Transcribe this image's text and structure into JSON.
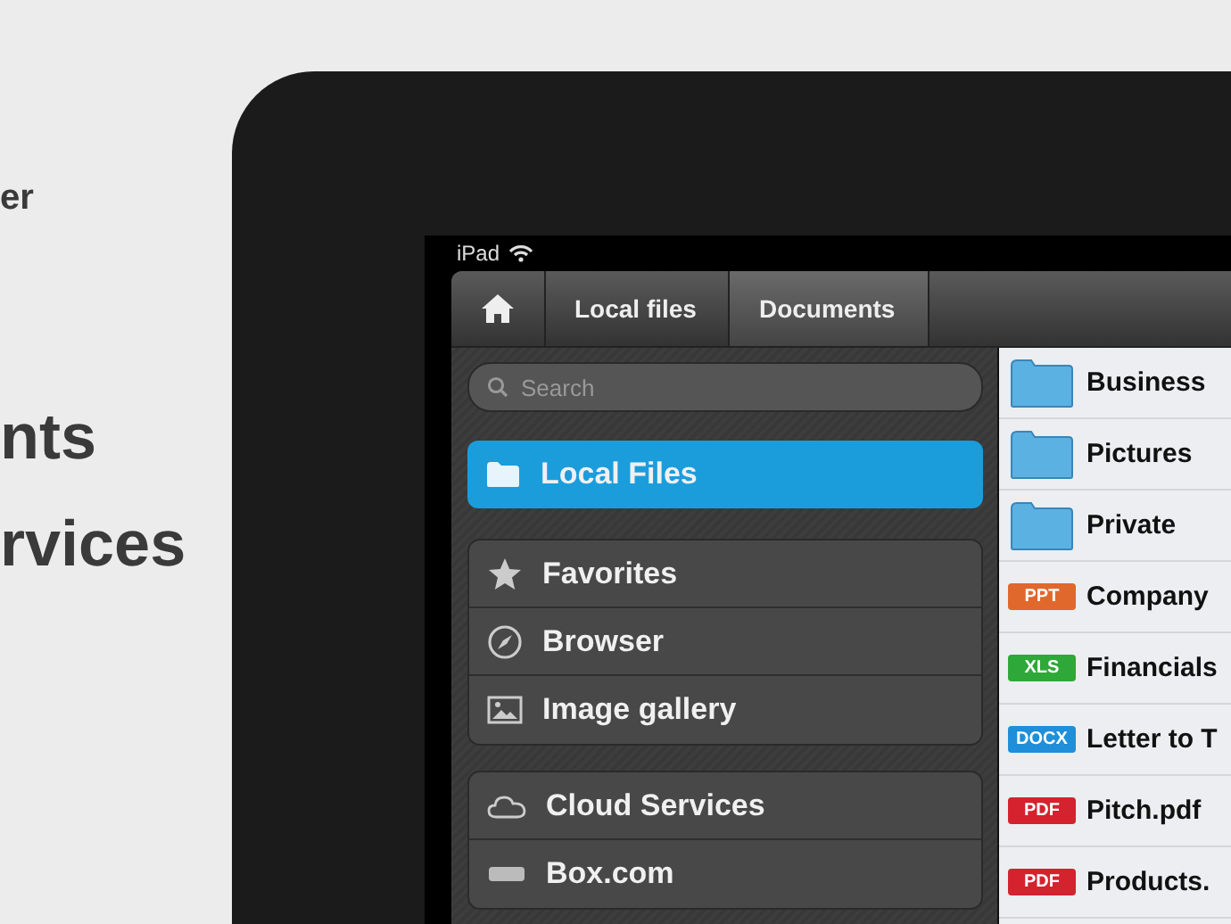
{
  "promo_text": [
    {
      "text": "er",
      "kind": "small"
    },
    {
      "text": "nts",
      "kind": "large"
    },
    {
      "text": "rvices",
      "kind": "large"
    }
  ],
  "status_bar": {
    "device": "iPad"
  },
  "breadcrumbs": [
    "Local files",
    "Documents"
  ],
  "search": {
    "placeholder": "Search"
  },
  "sidebar": {
    "top": {
      "label": "Local Files",
      "selected": true
    },
    "groups": [
      {
        "items": [
          {
            "label": "Favorites",
            "kind": "star",
            "selected": false
          },
          {
            "label": "Browser",
            "kind": "compass",
            "selected": false
          },
          {
            "label": "Image gallery",
            "kind": "image",
            "selected": false
          }
        ]
      },
      {
        "items": [
          {
            "label": "Cloud Services",
            "kind": "cloud",
            "selected": false
          },
          {
            "label": "Box.com",
            "kind": "box",
            "selected": false
          }
        ]
      }
    ]
  },
  "files": [
    {
      "kind": "folder",
      "name": "Business"
    },
    {
      "kind": "folder",
      "name": "Pictures"
    },
    {
      "kind": "folder",
      "name": "Private"
    },
    {
      "kind": "doc",
      "badge": "PPT",
      "color": "#e0682c",
      "name": "Company"
    },
    {
      "kind": "doc",
      "badge": "XLS",
      "color": "#2ea838",
      "name": "Financials"
    },
    {
      "kind": "doc",
      "badge": "DOCX",
      "color": "#1e8fd8",
      "name": "Letter to T"
    },
    {
      "kind": "doc",
      "badge": "PDF",
      "color": "#d4222e",
      "name": "Pitch.pdf"
    },
    {
      "kind": "doc",
      "badge": "PDF",
      "color": "#d4222e",
      "name": "Products."
    }
  ]
}
